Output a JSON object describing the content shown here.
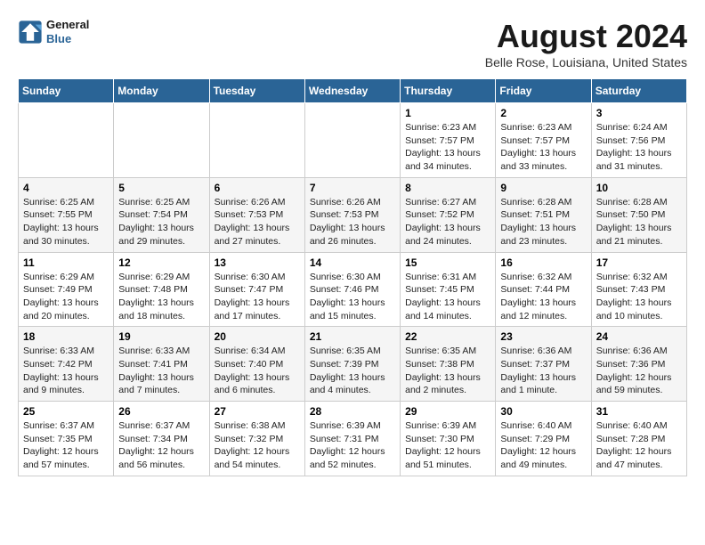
{
  "header": {
    "logo_line1": "General",
    "logo_line2": "Blue",
    "month_title": "August 2024",
    "location": "Belle Rose, Louisiana, United States"
  },
  "days_of_week": [
    "Sunday",
    "Monday",
    "Tuesday",
    "Wednesday",
    "Thursday",
    "Friday",
    "Saturday"
  ],
  "weeks": [
    [
      {
        "day": "",
        "info": ""
      },
      {
        "day": "",
        "info": ""
      },
      {
        "day": "",
        "info": ""
      },
      {
        "day": "",
        "info": ""
      },
      {
        "day": "1",
        "info": "Sunrise: 6:23 AM\nSunset: 7:57 PM\nDaylight: 13 hours\nand 34 minutes."
      },
      {
        "day": "2",
        "info": "Sunrise: 6:23 AM\nSunset: 7:57 PM\nDaylight: 13 hours\nand 33 minutes."
      },
      {
        "day": "3",
        "info": "Sunrise: 6:24 AM\nSunset: 7:56 PM\nDaylight: 13 hours\nand 31 minutes."
      }
    ],
    [
      {
        "day": "4",
        "info": "Sunrise: 6:25 AM\nSunset: 7:55 PM\nDaylight: 13 hours\nand 30 minutes."
      },
      {
        "day": "5",
        "info": "Sunrise: 6:25 AM\nSunset: 7:54 PM\nDaylight: 13 hours\nand 29 minutes."
      },
      {
        "day": "6",
        "info": "Sunrise: 6:26 AM\nSunset: 7:53 PM\nDaylight: 13 hours\nand 27 minutes."
      },
      {
        "day": "7",
        "info": "Sunrise: 6:26 AM\nSunset: 7:53 PM\nDaylight: 13 hours\nand 26 minutes."
      },
      {
        "day": "8",
        "info": "Sunrise: 6:27 AM\nSunset: 7:52 PM\nDaylight: 13 hours\nand 24 minutes."
      },
      {
        "day": "9",
        "info": "Sunrise: 6:28 AM\nSunset: 7:51 PM\nDaylight: 13 hours\nand 23 minutes."
      },
      {
        "day": "10",
        "info": "Sunrise: 6:28 AM\nSunset: 7:50 PM\nDaylight: 13 hours\nand 21 minutes."
      }
    ],
    [
      {
        "day": "11",
        "info": "Sunrise: 6:29 AM\nSunset: 7:49 PM\nDaylight: 13 hours\nand 20 minutes."
      },
      {
        "day": "12",
        "info": "Sunrise: 6:29 AM\nSunset: 7:48 PM\nDaylight: 13 hours\nand 18 minutes."
      },
      {
        "day": "13",
        "info": "Sunrise: 6:30 AM\nSunset: 7:47 PM\nDaylight: 13 hours\nand 17 minutes."
      },
      {
        "day": "14",
        "info": "Sunrise: 6:30 AM\nSunset: 7:46 PM\nDaylight: 13 hours\nand 15 minutes."
      },
      {
        "day": "15",
        "info": "Sunrise: 6:31 AM\nSunset: 7:45 PM\nDaylight: 13 hours\nand 14 minutes."
      },
      {
        "day": "16",
        "info": "Sunrise: 6:32 AM\nSunset: 7:44 PM\nDaylight: 13 hours\nand 12 minutes."
      },
      {
        "day": "17",
        "info": "Sunrise: 6:32 AM\nSunset: 7:43 PM\nDaylight: 13 hours\nand 10 minutes."
      }
    ],
    [
      {
        "day": "18",
        "info": "Sunrise: 6:33 AM\nSunset: 7:42 PM\nDaylight: 13 hours\nand 9 minutes."
      },
      {
        "day": "19",
        "info": "Sunrise: 6:33 AM\nSunset: 7:41 PM\nDaylight: 13 hours\nand 7 minutes."
      },
      {
        "day": "20",
        "info": "Sunrise: 6:34 AM\nSunset: 7:40 PM\nDaylight: 13 hours\nand 6 minutes."
      },
      {
        "day": "21",
        "info": "Sunrise: 6:35 AM\nSunset: 7:39 PM\nDaylight: 13 hours\nand 4 minutes."
      },
      {
        "day": "22",
        "info": "Sunrise: 6:35 AM\nSunset: 7:38 PM\nDaylight: 13 hours\nand 2 minutes."
      },
      {
        "day": "23",
        "info": "Sunrise: 6:36 AM\nSunset: 7:37 PM\nDaylight: 13 hours\nand 1 minute."
      },
      {
        "day": "24",
        "info": "Sunrise: 6:36 AM\nSunset: 7:36 PM\nDaylight: 12 hours\nand 59 minutes."
      }
    ],
    [
      {
        "day": "25",
        "info": "Sunrise: 6:37 AM\nSunset: 7:35 PM\nDaylight: 12 hours\nand 57 minutes."
      },
      {
        "day": "26",
        "info": "Sunrise: 6:37 AM\nSunset: 7:34 PM\nDaylight: 12 hours\nand 56 minutes."
      },
      {
        "day": "27",
        "info": "Sunrise: 6:38 AM\nSunset: 7:32 PM\nDaylight: 12 hours\nand 54 minutes."
      },
      {
        "day": "28",
        "info": "Sunrise: 6:39 AM\nSunset: 7:31 PM\nDaylight: 12 hours\nand 52 minutes."
      },
      {
        "day": "29",
        "info": "Sunrise: 6:39 AM\nSunset: 7:30 PM\nDaylight: 12 hours\nand 51 minutes."
      },
      {
        "day": "30",
        "info": "Sunrise: 6:40 AM\nSunset: 7:29 PM\nDaylight: 12 hours\nand 49 minutes."
      },
      {
        "day": "31",
        "info": "Sunrise: 6:40 AM\nSunset: 7:28 PM\nDaylight: 12 hours\nand 47 minutes."
      }
    ]
  ]
}
